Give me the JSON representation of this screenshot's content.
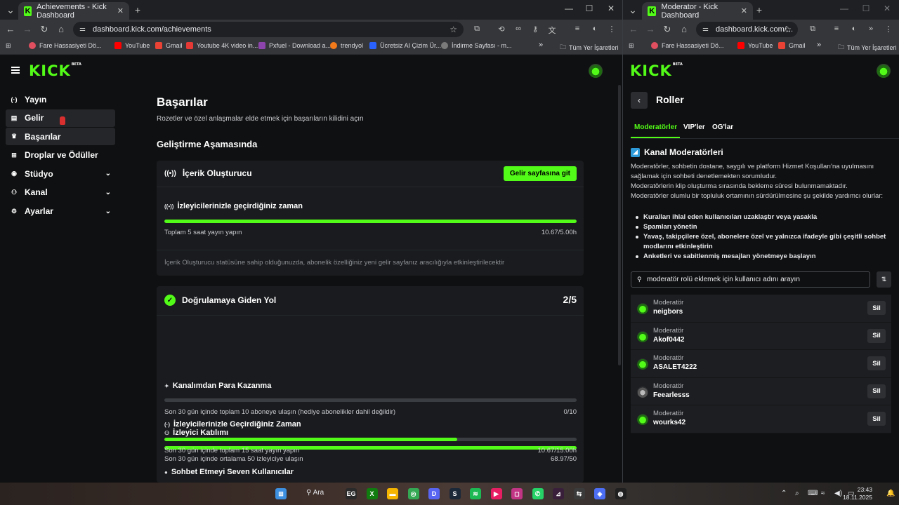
{
  "left_window": {
    "tab_title": "Achievements - Kick Dashboard",
    "tab_icon": "K",
    "url": "dashboard.kick.com/achievements",
    "bookmarks": [
      {
        "label": "Fare Hassasiyeti Dö...",
        "color": "#e04f5f"
      },
      {
        "label": "YouTube",
        "color": "#ff0000"
      },
      {
        "label": "Gmail",
        "color": "#ea4335"
      },
      {
        "label": "Youtube 4K video in...",
        "color": "#e53935"
      },
      {
        "label": "Pxfuel - Download a...",
        "color": "#8e44ad"
      },
      {
        "label": "trendyol",
        "color": "#f27a1a"
      },
      {
        "label": "Ücretsiz AI Çizim Ür...",
        "color": "#2962ff"
      },
      {
        "label": "İndirme Sayfası - m...",
        "color": "#7a7a7a"
      }
    ],
    "bookmarks_more": "»",
    "all_bookmarks": "Tüm Yer İşaretleri"
  },
  "right_window": {
    "tab_title": "Moderator - Kick Dashboard",
    "tab_icon": "K",
    "url": "dashboard.kick.com/...",
    "bookmarks": [
      {
        "label": "Fare Hassasiyeti Dö...",
        "color": "#e04f5f"
      },
      {
        "label": "YouTube",
        "color": "#ff0000"
      },
      {
        "label": "Gmail",
        "color": "#ea4335"
      }
    ],
    "bookmarks_more": "»",
    "all_bookmarks": "Tüm Yer İşaretleri"
  },
  "kick": {
    "logo": "KICK",
    "logo_badge": "BETA",
    "accent": "#53fc18"
  },
  "sidebar": {
    "items": [
      {
        "label": "Yayın",
        "icon": "broadcast-icon",
        "glyph": "(·)"
      },
      {
        "label": "Gelir",
        "icon": "revenue-icon",
        "glyph": "▤"
      },
      {
        "label": "Başarılar",
        "icon": "trophy-icon",
        "glyph": "🏆"
      },
      {
        "label": "Droplar ve Ödüller",
        "icon": "gift-icon",
        "glyph": "⊞"
      },
      {
        "label": "Stüdyo",
        "icon": "studio-icon",
        "glyph": "◉"
      },
      {
        "label": "Kanal",
        "icon": "channel-icon",
        "glyph": "⚇"
      },
      {
        "label": "Ayarlar",
        "icon": "gear-icon",
        "glyph": "⚙"
      }
    ]
  },
  "achievements": {
    "title": "Başarılar",
    "subtitle": "Rozetler ve özel anlaşmalar elde etmek için başarıların kilidini açın",
    "section_title": "Geliştirme Aşamasında",
    "creator_card": {
      "title": "İçerik Oluşturucu",
      "button": "Gelir sayfasına git",
      "item_title": "İzleyicilerinizle geçirdiğiniz zaman",
      "progress": 1.0,
      "desc": "Toplam 5 saat yayın yapın",
      "value": "10.67/5.00h",
      "note": "İçerik Oluşturucu statüsüne sahip olduğunuzda, abonelik özelliğiniz yeni gelir sayfanız aracılığıyla etkinleştirilecektir"
    },
    "verify_card": {
      "title": "Doğrulamaya Giden Yol",
      "count": "2/5",
      "items": [
        {
          "title": "Kanalımdan Para Kazanma",
          "icon": "sparkle-icon",
          "glyph": "✦",
          "progress": 0.0,
          "desc": "Son 30 gün içinde toplam 10 aboneye ulaşın (hediye abonelikler dahil değildir)",
          "value": "0/10"
        },
        {
          "title": "İzleyici Katılımı",
          "icon": "users-icon",
          "glyph": "⚇",
          "progress": 1.0,
          "desc": "Son 30 gün içinde ortalama 50 izleyiciye ulaşın",
          "value": "68.97/50"
        },
        {
          "title": "İzleyicilerinizle Geçirdiğiniz Zaman",
          "icon": "broadcast-icon",
          "glyph": "(·)",
          "progress": 0.711,
          "desc": "Son 30 gün içinde toplam 15 saat yayın yapın",
          "value": "10.67/15.00h"
        },
        {
          "title": "Sohbet Etmeyi Seven Kullanıcılar",
          "icon": "chat-icon",
          "glyph": "●"
        }
      ]
    }
  },
  "roles": {
    "title": "Roller",
    "tabs": [
      "Moderatörler",
      "VIP'ler",
      "OG'lar"
    ],
    "channel_moderators_title": "Kanal Moderatörleri",
    "para1": "Moderatörler, sohbetin dostane, saygılı ve platform Hizmet Koşulları'na uyulmasını sağlamak için sohbeti denetlemekten sorumludur.",
    "para2": "Moderatörlerin klip oluşturma sırasında bekleme süresi bulunmamaktadır.",
    "para3": "Moderatörler olumlu bir topluluk ortamının sürdürülmesine şu şekilde yardımcı olurlar:",
    "bullets": [
      "Kuralları ihlal eden kullanıcıları uzaklaştır veya yasakla",
      "Spamları yönetin",
      "Yavaş, takipçilere özel, abonelere özel ve yalnızca ifadeyle gibi çeşitli sohbet modlarını etkinleştirin",
      "Anketleri ve sabitlenmiş mesajları yönetmeye başlayın"
    ],
    "search_placeholder": "moderatör rolü eklemek için kullanıcı adını arayın",
    "moderators": [
      {
        "role": "Moderatör",
        "name": "neigbors",
        "action": "Sil"
      },
      {
        "role": "Moderatör",
        "name": "Akof0442",
        "action": "Sil"
      },
      {
        "role": "Moderatör",
        "name": "ASALET4222",
        "action": "Sil"
      },
      {
        "role": "Moderatör",
        "name": "Feearlesss",
        "action": "Sil"
      },
      {
        "role": "Moderatör",
        "name": "wourks42",
        "action": "Sil"
      }
    ]
  },
  "taskbar": {
    "search_label": "Ara",
    "time": "23:43",
    "date": "18.11.2025",
    "apps": [
      {
        "name": "epic-games-icon",
        "color": "#2a2a2a",
        "glyph": "EG"
      },
      {
        "name": "xbox-icon",
        "color": "#107c10",
        "glyph": "X"
      },
      {
        "name": "file-explorer-icon",
        "color": "#f4b400",
        "glyph": "▬"
      },
      {
        "name": "chrome-icon",
        "color": "#34a853",
        "glyph": "◎"
      },
      {
        "name": "discord-icon",
        "color": "#5865f2",
        "glyph": "D"
      },
      {
        "name": "steam-icon",
        "color": "#1b2838",
        "glyph": "S"
      },
      {
        "name": "spotify-icon",
        "color": "#1db954",
        "glyph": "≋"
      },
      {
        "name": "media-player-icon",
        "color": "#e81e63",
        "glyph": "▶"
      },
      {
        "name": "instagram-icon",
        "color": "#c13584",
        "glyph": "◻"
      },
      {
        "name": "whatsapp-icon",
        "color": "#25d366",
        "glyph": "✆"
      },
      {
        "name": "editor-icon",
        "color": "#3a1f3a",
        "glyph": "⊿"
      },
      {
        "name": "vpn-icon",
        "color": "#3b3b3b",
        "glyph": "⇆"
      },
      {
        "name": "nvidia-icon",
        "color": "#4c6ef5",
        "glyph": "◈"
      },
      {
        "name": "obs-icon",
        "color": "#202020",
        "glyph": "◍"
      }
    ]
  }
}
